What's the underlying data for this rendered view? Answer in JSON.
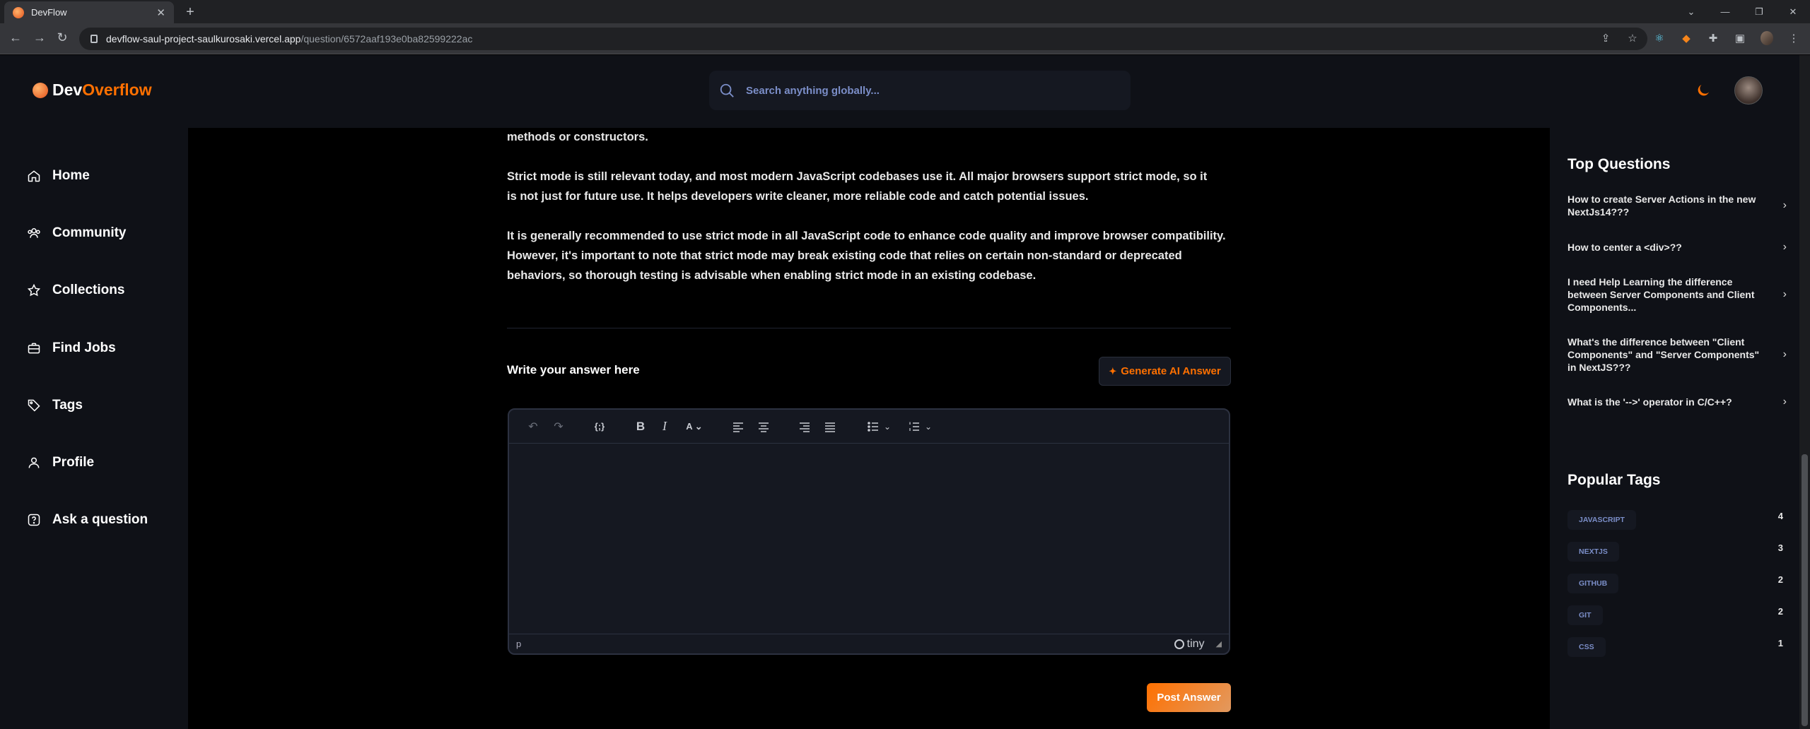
{
  "browser": {
    "tab_title": "DevFlow",
    "url_host": "devflow-saul-project-saulkurosaki.vercel.app",
    "url_path": "/question/6572aaf193e0ba82599222ac"
  },
  "header": {
    "logo_prefix": "Dev",
    "logo_suffix": "Overflow",
    "search_placeholder": "Search anything globally..."
  },
  "sidebar": {
    "items": [
      {
        "label": "Home",
        "icon": "home-icon"
      },
      {
        "label": "Community",
        "icon": "users-icon"
      },
      {
        "label": "Collections",
        "icon": "star-icon"
      },
      {
        "label": "Find Jobs",
        "icon": "suitcase-icon"
      },
      {
        "label": "Tags",
        "icon": "tag-icon"
      },
      {
        "label": "Profile",
        "icon": "user-icon"
      },
      {
        "label": "Ask a question",
        "icon": "question-icon"
      }
    ]
  },
  "content": {
    "paragraphs": [
      "methods or constructors.",
      "Strict mode is still relevant today, and most modern JavaScript codebases use it. All major browsers support strict mode, so it is not just for future use. It helps developers write cleaner, more reliable code and catch potential issues.",
      "It is generally recommended to use strict mode in all JavaScript code to enhance code quality and improve browser compatibility. However, it's important to note that strict mode may break existing code that relies on certain non-standard or deprecated behaviors, so thorough testing is advisable when enabling strict mode in an existing codebase."
    ],
    "answer_label": "Write your answer here",
    "generate_label": "Generate AI Answer",
    "editor_status_path": "p",
    "editor_brand": "tiny",
    "post_label": "Post Answer"
  },
  "right_sidebar": {
    "top_questions_title": "Top Questions",
    "top_questions": [
      "How to create Server Actions in the new NextJs14???",
      "How to center a <div>??",
      "I need Help Learning the difference between Server Components and Client Components...",
      "What's the difference between \"Client Components\" and \"Server Components\" in NextJS???",
      "What is the '-->' operator in C/C++?"
    ],
    "popular_tags_title": "Popular Tags",
    "tags": [
      {
        "name": "JAVASCRIPT",
        "count": "4"
      },
      {
        "name": "NEXTJS",
        "count": "3"
      },
      {
        "name": "GITHUB",
        "count": "2"
      },
      {
        "name": "GIT",
        "count": "2"
      },
      {
        "name": "CSS",
        "count": "1"
      }
    ]
  },
  "colors": {
    "accent": "#ff7000",
    "background": "#000000",
    "panel": "#0f1117",
    "input": "#151821",
    "tag_text": "#7b8ec8"
  }
}
